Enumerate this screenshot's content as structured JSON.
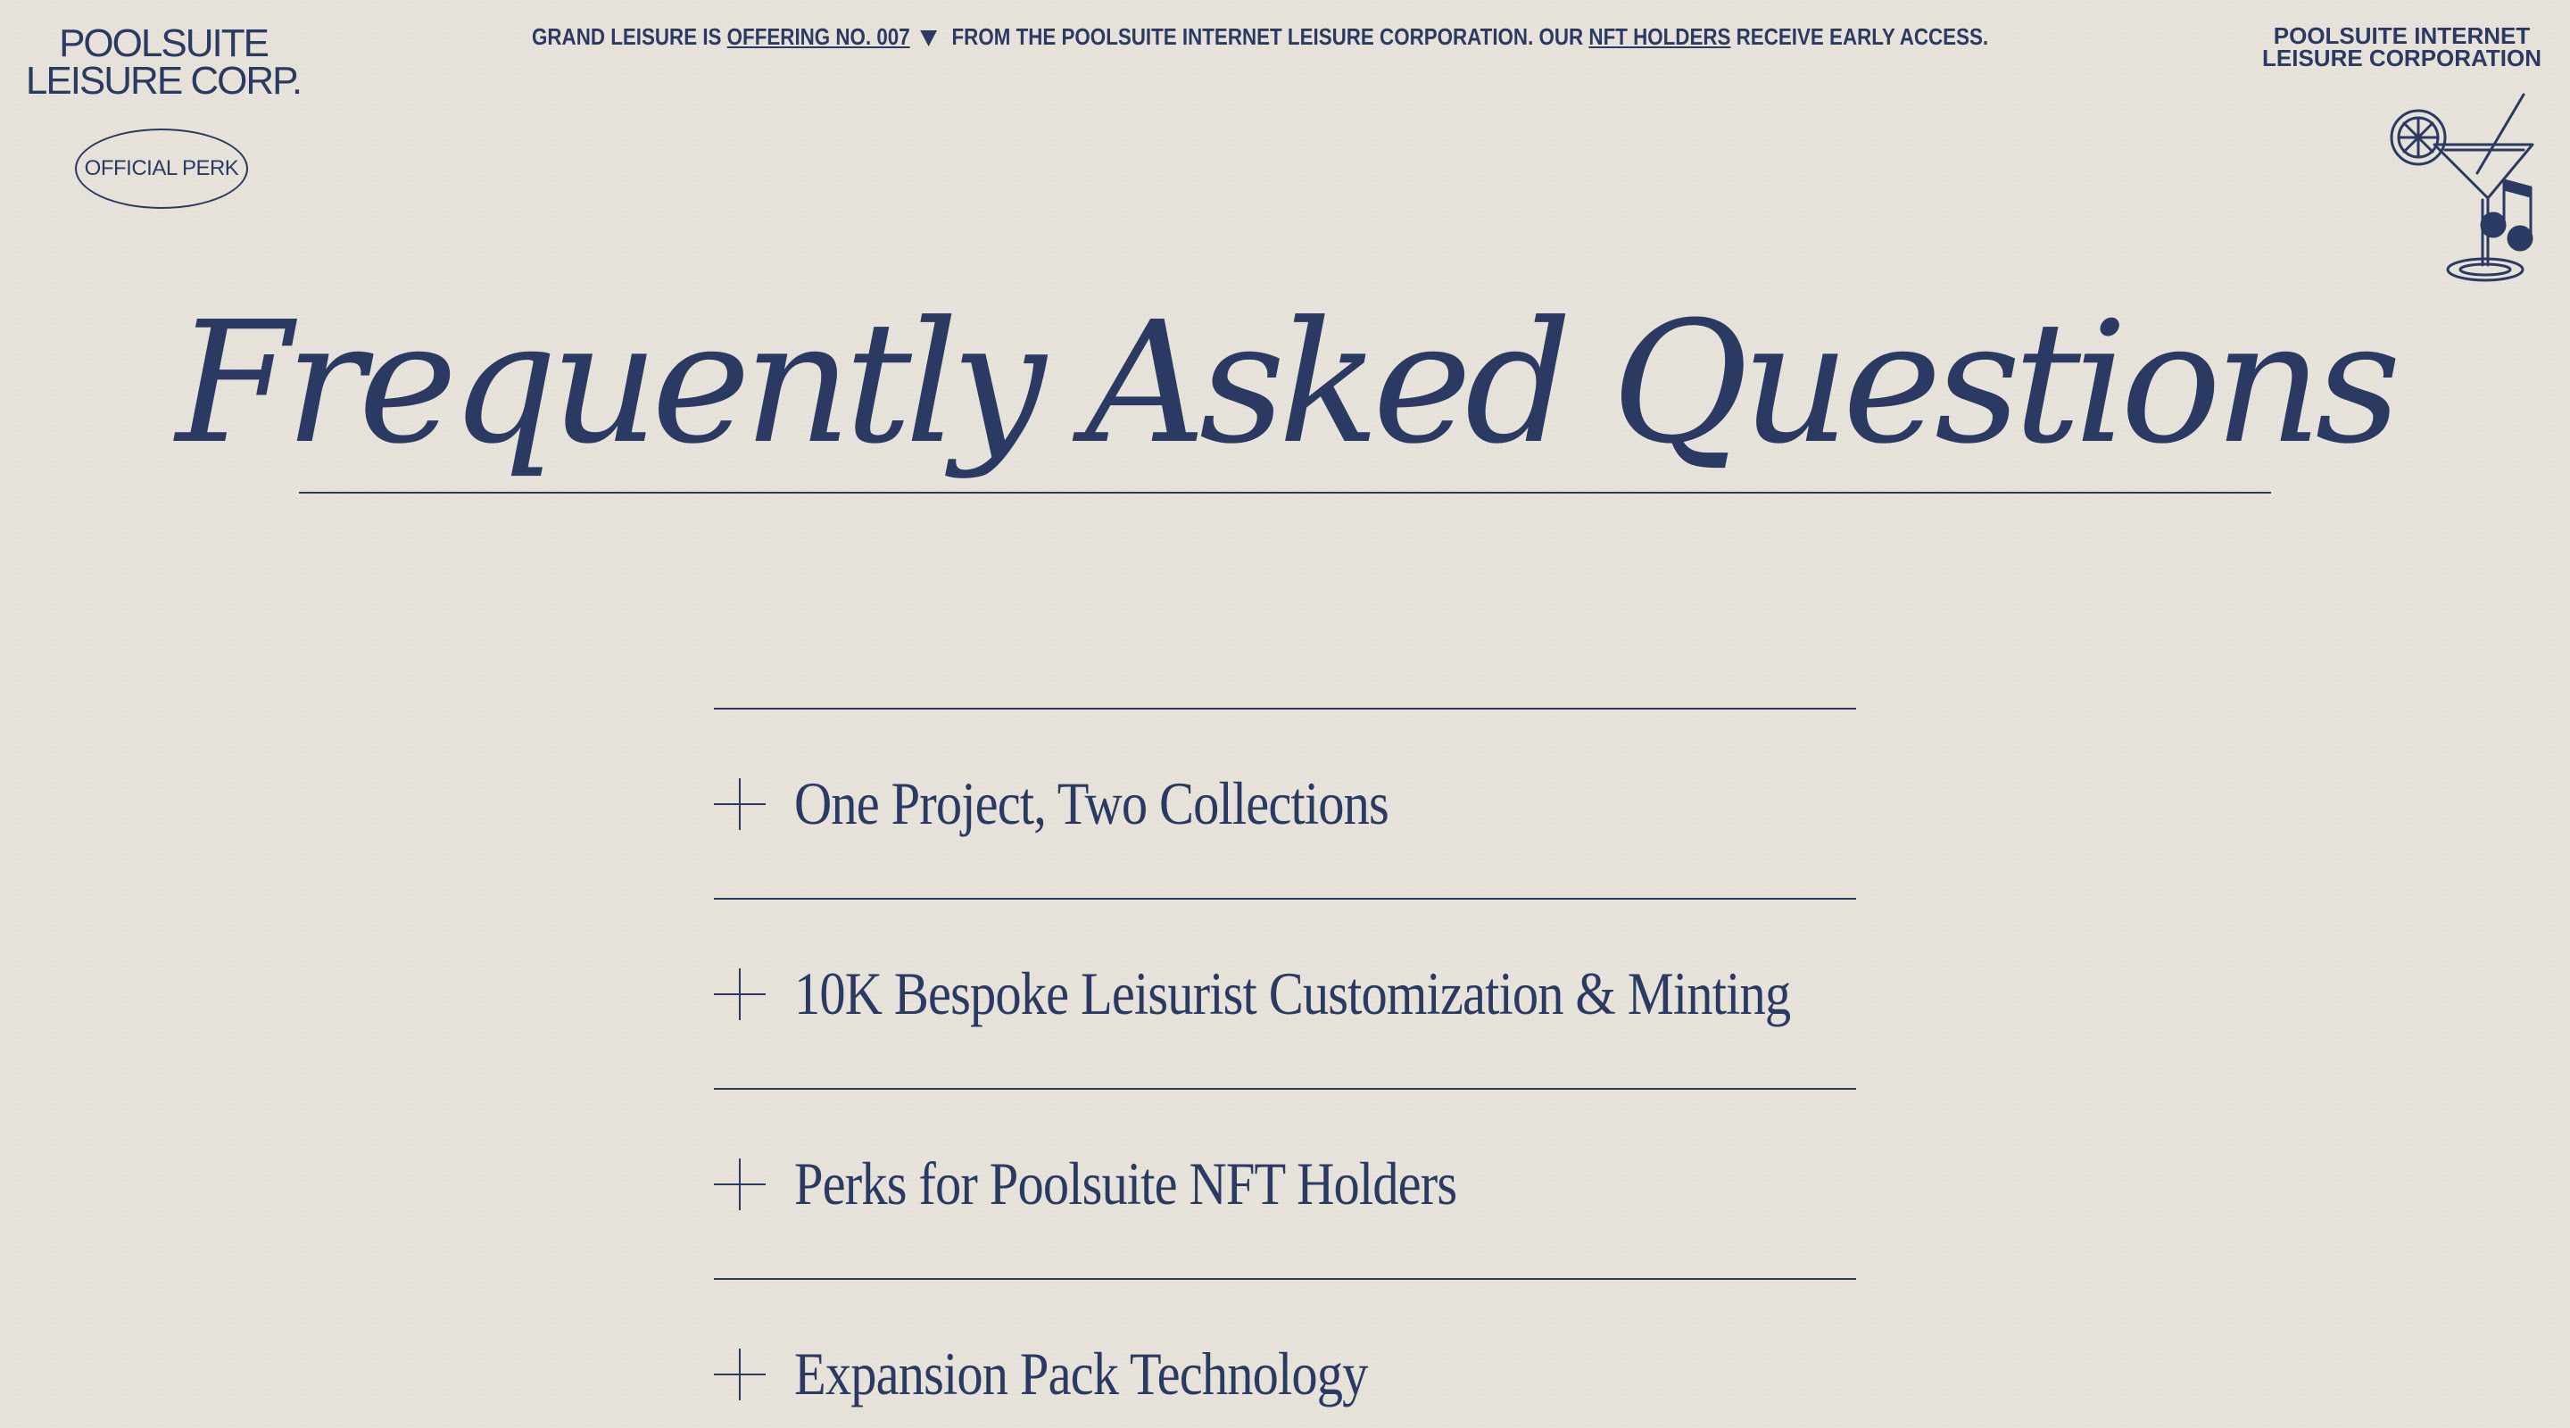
{
  "header": {
    "logo_line1": "POOLSUITE",
    "logo_line2": "LEISURE CORP.",
    "perk_badge": "OFFICIAL PERK",
    "banner": {
      "text1": "GRAND LEISURE IS",
      "link1": "OFFERING NO. 007",
      "text2": "FROM THE POOLSUITE INTERNET LEISURE CORPORATION. OUR",
      "link2": "NFT HOLDERS",
      "text3": "RECEIVE EARLY ACCESS."
    },
    "corp_line1": "POOLSUITE INTERNET",
    "corp_line2": "LEISURE CORPORATION",
    "cocktail_icon": "cocktail-glass-music-note-icon"
  },
  "main": {
    "title": "Frequently Asked Questions",
    "faq": [
      {
        "label": "One Project, Two Collections"
      },
      {
        "label": "10K Bespoke Leisurist Customization & Minting"
      },
      {
        "label": "Perks for Poolsuite NFT Holders"
      },
      {
        "label": "Expansion Pack Technology"
      }
    ]
  },
  "colors": {
    "background": "#e7e3da",
    "ink": "#2b3a63"
  }
}
